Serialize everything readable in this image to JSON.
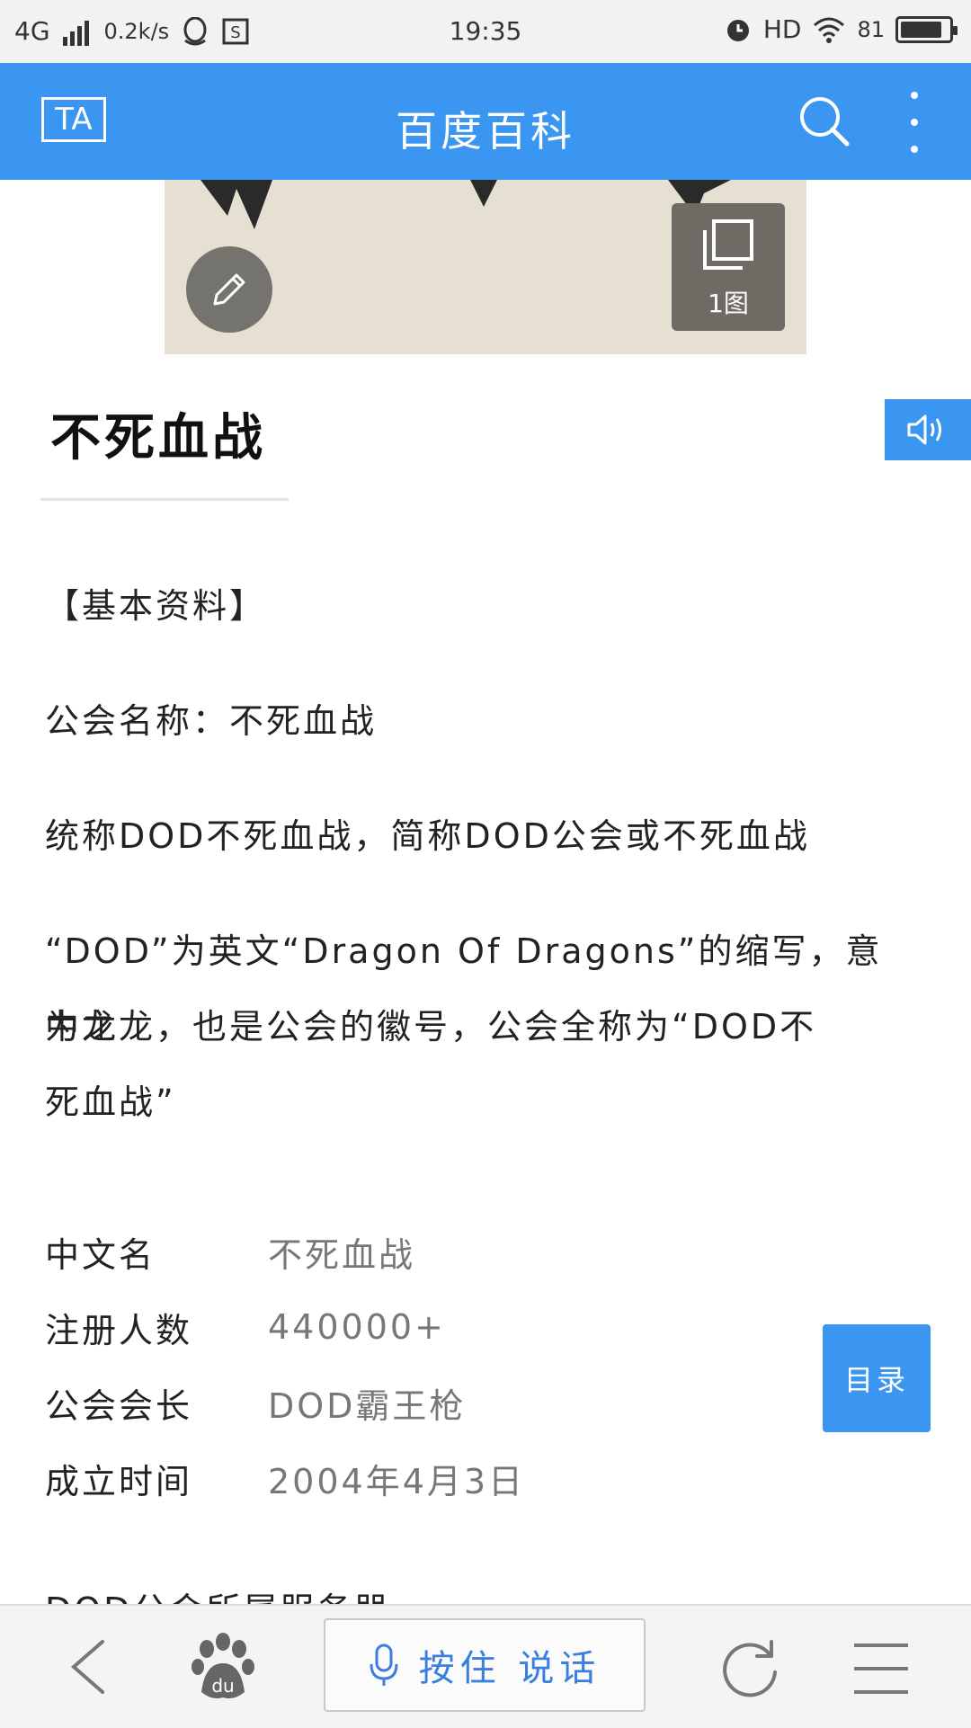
{
  "status_bar": {
    "network": "4G",
    "speed": "0.2k/s",
    "time": "19:35",
    "hd": "HD",
    "battery": "81"
  },
  "top_bar": {
    "ta_label": "TA",
    "title": "百度百科",
    "search_icon": "search-icon",
    "more_icon": "more-vertical-icon"
  },
  "hero": {
    "edit_icon": "pencil-icon",
    "image_count": "1图"
  },
  "entry": {
    "title": "不死血战"
  },
  "content": {
    "section_heading": "【基本资料】",
    "guild_name": "公会名称：不死血战",
    "alias": "统称DOD不死血战，简称DOD公会或不死血战",
    "desc_line1": "“DOD”为英文“Dragon Of Dragons”的缩写，意为龙",
    "desc_line2": "中之龙，也是公会的徽号，公会全称为“DOD不",
    "desc_line3": "死血战”",
    "cut_text": "DOD公会所属服务器"
  },
  "info": [
    {
      "key": "中文名",
      "value": "不死血战"
    },
    {
      "key": "注册人数",
      "value": "440000+"
    },
    {
      "key": "公会会长",
      "value": "DOD霸王枪"
    },
    {
      "key": "成立时间",
      "value": "2004年4月3日"
    }
  ],
  "toc_button": "目录",
  "bottom_bar": {
    "back_icon": "back-arrow-icon",
    "paw_icon": "baidu-paw-icon",
    "voice_label": "按住 说话",
    "refresh_icon": "refresh-icon",
    "menu_icon": "menu-icon"
  },
  "colors": {
    "accent": "#3a96f0",
    "status_bar_bg": "#f2f2f2"
  }
}
